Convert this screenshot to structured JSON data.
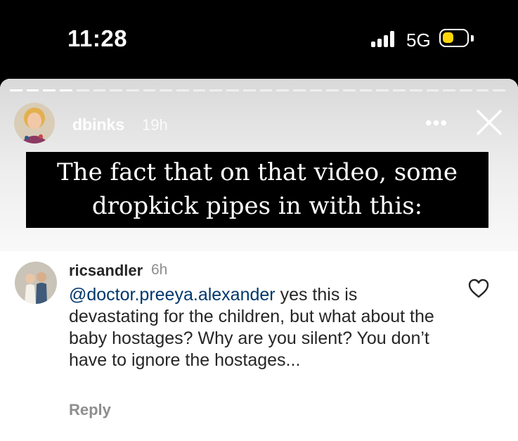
{
  "status_bar": {
    "time": "11:28",
    "network": "5G",
    "battery_level": 0.45,
    "accent_color": "#ffd60a"
  },
  "story": {
    "username": "dbinks",
    "timestamp": "19h",
    "more_icon": "more-dots-icon",
    "close_icon": "close-icon",
    "caption_lines": [
      "The fact that on that video, some",
      "dropkick pipes in with this:"
    ]
  },
  "comment": {
    "username": "ricsandler",
    "timestamp": "6h",
    "mention": "@doctor.preeya.alexander",
    "text": " yes this is devastating for the children, but what about the baby hostages? Why are you silent? You don’t have to ignore the hostages...",
    "reply_label": "Reply",
    "like_icon": "heart-outline-icon",
    "mention_color": "#00376b"
  }
}
